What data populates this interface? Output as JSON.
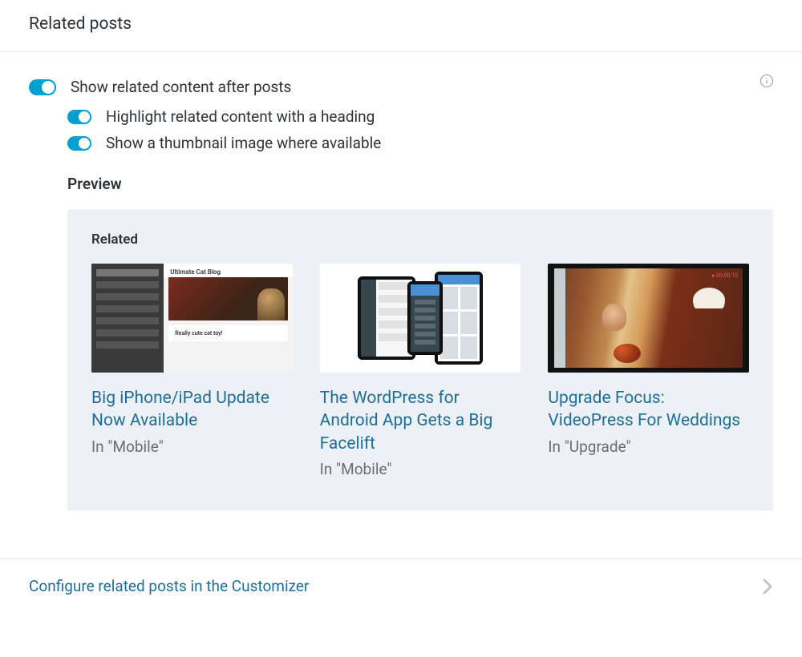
{
  "section_title": "Related posts",
  "main_toggle": {
    "label": "Show related content after posts",
    "on": true
  },
  "sub_toggles": [
    {
      "label": "Highlight related content with a heading",
      "on": true
    },
    {
      "label": "Show a thumbnail image where available",
      "on": true
    }
  ],
  "preview_heading": "Preview",
  "preview_label": "Related",
  "cards": [
    {
      "title": "Big iPhone/iPad Update Now Available",
      "meta": "In \"Mobile\"",
      "thumb_caption_top": "Ultimate Cat Blog",
      "thumb_caption_bottom": "Really cute cat toy!"
    },
    {
      "title": "The WordPress for Android App Gets a Big Facelift",
      "meta": "In \"Mobile\""
    },
    {
      "title": "Upgrade Focus: VideoPress For Weddings",
      "meta": "In \"Upgrade\""
    }
  ],
  "footer_link": "Configure related posts in the Customizer",
  "colors": {
    "accent": "#00a0d2",
    "link": "#1b6f9a",
    "preview_bg": "#edf1f5",
    "border": "#e6e8eb",
    "muted": "#686e73"
  }
}
